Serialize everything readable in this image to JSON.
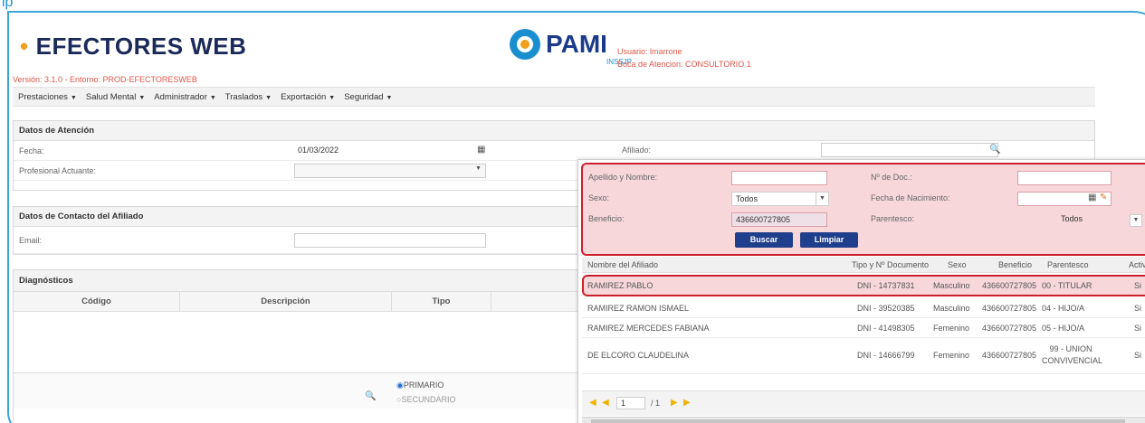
{
  "app": {
    "corner_label": "lp",
    "title": "EFECTORES WEB",
    "version": "Versión: 3.1.0 - Entorno: PROD-EFECTORESWEB",
    "logo_text": "PAMI",
    "logo_sub": "INSSJP",
    "user_line": "Usuario: lmarrone",
    "attention_line": "Boca de Atencion: CONSULTORIO 1"
  },
  "menu": {
    "items": [
      {
        "label": "Prestaciones"
      },
      {
        "label": "Salud Mental"
      },
      {
        "label": "Administrador"
      },
      {
        "label": "Traslados"
      },
      {
        "label": "Exportación"
      },
      {
        "label": "Seguridad"
      }
    ]
  },
  "atencion": {
    "title": "Datos de Atención",
    "fecha_label": "Fecha:",
    "fecha_value": "01/03/2022",
    "profesional_label": "Profesional Actuante:",
    "afiliado_label": "Afiliado:"
  },
  "contacto": {
    "title": "Datos de Contacto del Afiliado",
    "email_label": "Email:"
  },
  "diagnosticos": {
    "title": "Diagnósticos",
    "columns": [
      "Código",
      "Descripción",
      "Tipo"
    ],
    "radio_primary": "PRIMARIO",
    "radio_secondary": "SECUNDARIO"
  },
  "search": {
    "apellido_label": "Apellido y Nombre:",
    "doc_label": "Nº de Doc.:",
    "sexo_label": "Sexo:",
    "sexo_value": "Todos",
    "fecha_nac_label": "Fecha de Nacimiento:",
    "beneficio_label": "Beneficio:",
    "beneficio_value": "436600727805",
    "parentesco_label": "Parentesco:",
    "parentesco_value": "Todos",
    "buscar_label": "Buscar",
    "limpiar_label": "Limpiar"
  },
  "results": {
    "columns": [
      "Nombre del Afiliado",
      "Tipo y Nº Documento",
      "Sexo",
      "Beneficio",
      "Parentesco",
      "Activ"
    ],
    "rows": [
      {
        "nombre": "RAMIREZ PABLO",
        "doc": "DNI - 14737831",
        "sexo": "Masculino",
        "beneficio": "436600727805",
        "parentesco": "00 - TITULAR",
        "activo": "Si"
      },
      {
        "nombre": "RAMIREZ RAMON ISMAEL",
        "doc": "DNI - 39520385",
        "sexo": "Masculino",
        "beneficio": "436600727805",
        "parentesco": "04 - HIJO/A",
        "activo": "Si"
      },
      {
        "nombre": "RAMIREZ MERCEDES FABIANA",
        "doc": "DNI - 41498305",
        "sexo": "Femenino",
        "beneficio": "436600727805",
        "parentesco": "05 - HIJO/A",
        "activo": "Si"
      },
      {
        "nombre": "DE ELCORO CLAUDELINA",
        "doc": "DNI - 14666799",
        "sexo": "Femenino",
        "beneficio": "436600727805",
        "parentesco": "99 - UNION CONVIVENCIAL",
        "activo": "Si"
      }
    ],
    "pager_page": "1",
    "pager_total": "/ 1"
  },
  "colors": {
    "brand_navy": "#1b2a5a",
    "accent_orange": "#f0a01e",
    "highlight_red": "#cc1f2c",
    "button_blue": "#1f3f8c"
  }
}
